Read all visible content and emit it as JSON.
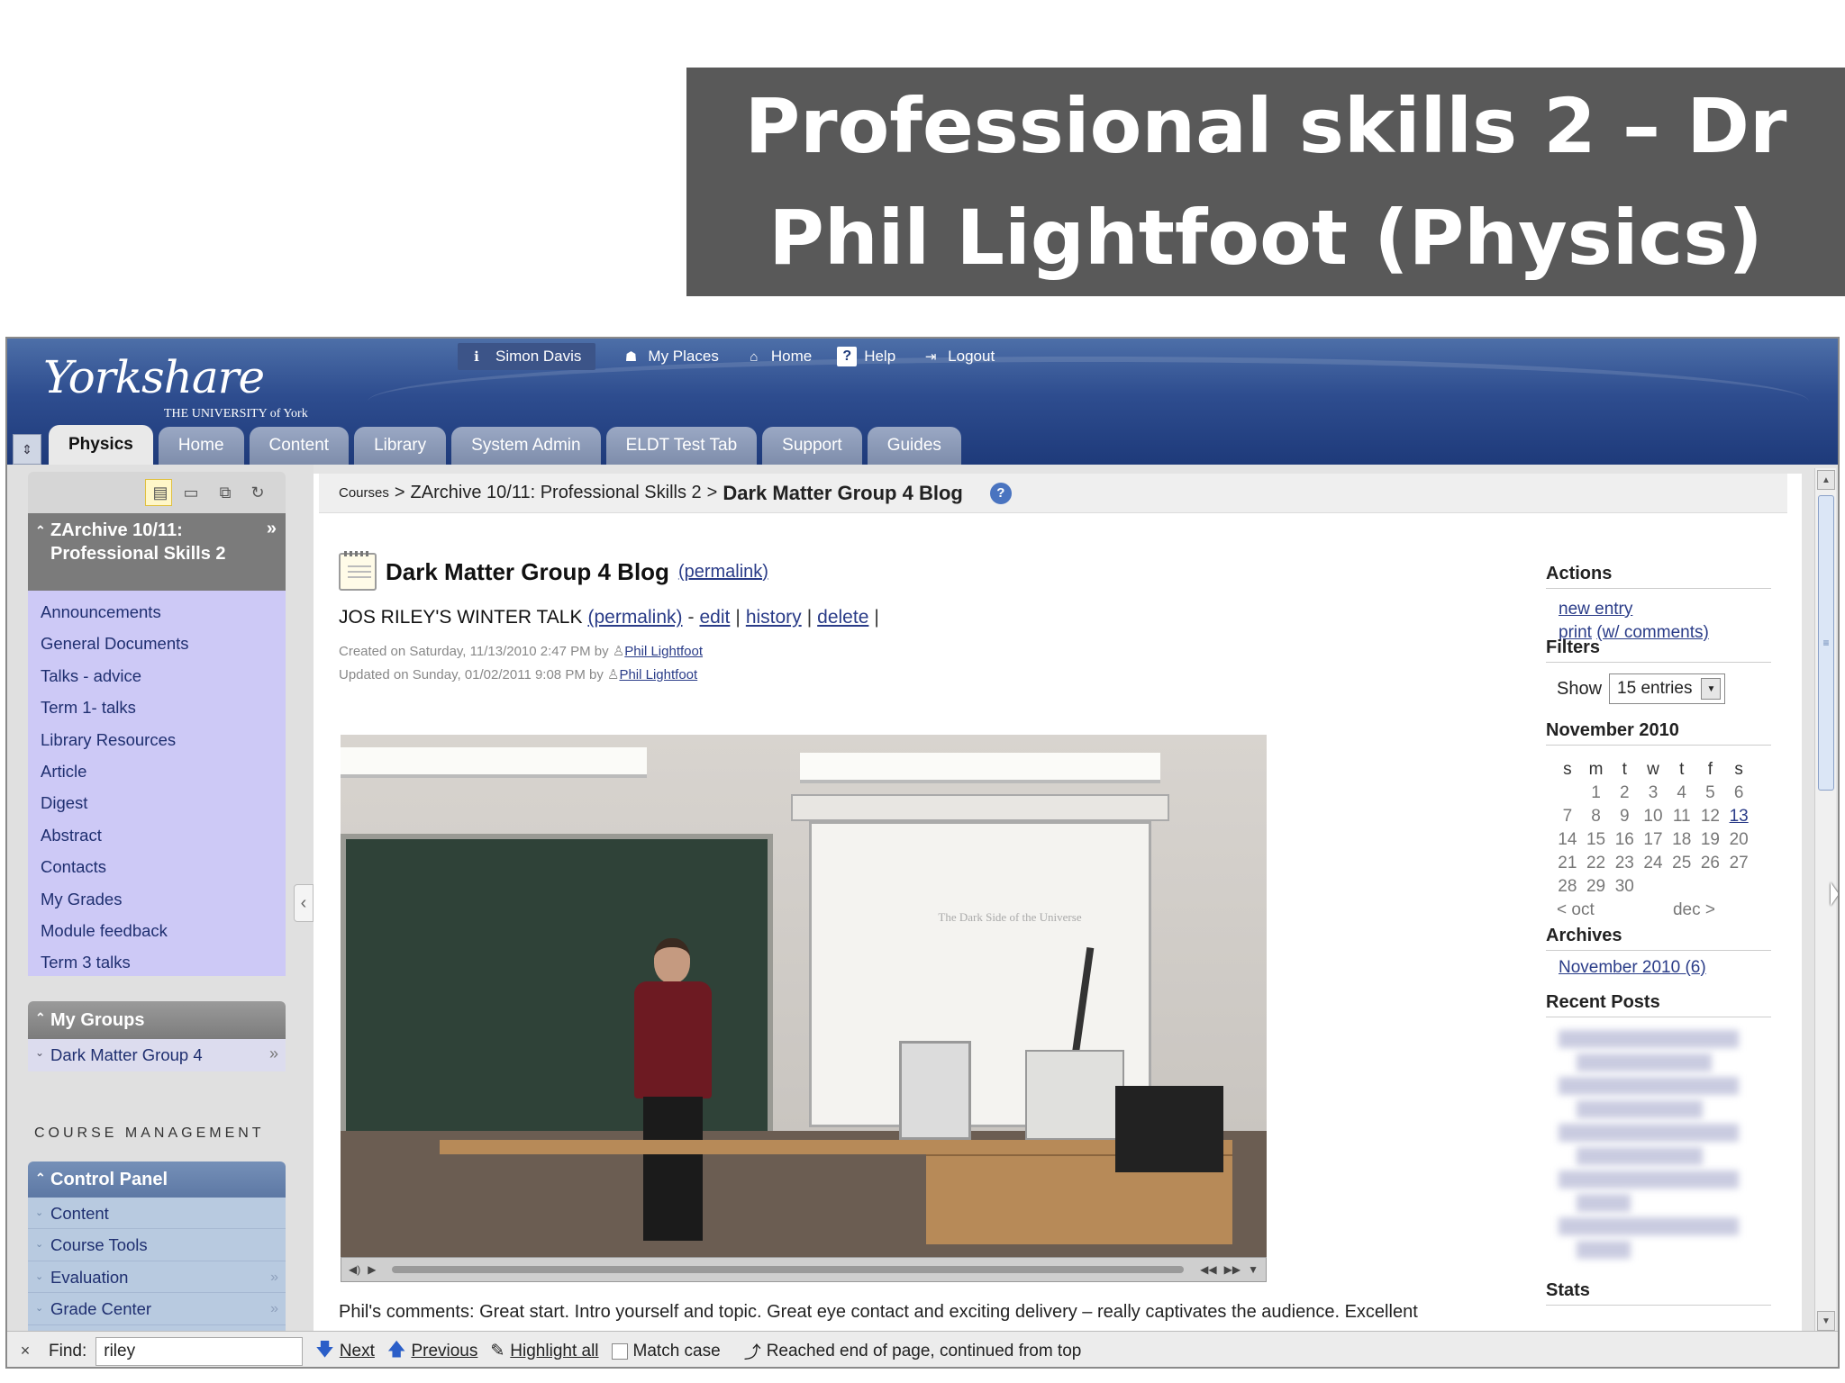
{
  "slide": {
    "title": "Professional skills 2 – Dr Phil Lightfoot (Physics)"
  },
  "header": {
    "logo_main": "Yorkshare",
    "logo_sub": "THE UNIVERSITY of York",
    "user": "Simon Davis",
    "top_links": [
      "My Places",
      "Home",
      "Help",
      "Logout"
    ]
  },
  "tabs": [
    "Physics",
    "Home",
    "Content",
    "Library",
    "System Admin",
    "ELDT Test Tab",
    "Support",
    "Guides"
  ],
  "leftnav": {
    "module_title": "ZArchive 10/11: Professional Skills 2",
    "module_links": [
      "Announcements",
      "General Documents",
      "Talks - advice",
      "Term 1- talks",
      "Library Resources",
      "Article",
      "Digest",
      "Abstract",
      "Contacts",
      "My Grades",
      "Module feedback",
      "Term 3 talks"
    ],
    "groups_title": "My Groups",
    "group_item": "Dark Matter Group 4",
    "course_management": "COURSE MANAGEMENT",
    "control_panel": "Control Panel",
    "cp_links": [
      "Content",
      "Course Tools",
      "Evaluation",
      "Grade Center"
    ]
  },
  "breadcrumb": {
    "root": "Courses",
    "module": "ZArchive 10/11: Professional Skills 2",
    "current": "Dark Matter Group 4 Blog",
    "sep": ">"
  },
  "blog": {
    "title": "Dark Matter Group 4 Blog",
    "permalink": "(permalink)",
    "entry_title": "JOS RILEY'S WINTER TALK",
    "entry_permalink": "(permalink)",
    "edit": "edit",
    "history": "history",
    "delete": "delete",
    "created_prefix": "Created on Saturday, 11/13/2010 2:47 PM by",
    "updated_prefix": "Updated on Sunday, 01/02/2011 9:08 PM by",
    "author": "Phil Lightfoot",
    "slide_text": "The Dark Side of the Universe",
    "comments": "Phil's comments: Great start. Intro yourself and topic. Great eye contact and exciting delivery – really captivates the audience. Excellent"
  },
  "sidebar": {
    "actions_heading": "Actions",
    "new_entry": "new entry",
    "print": "print",
    "print_comments": "(w/ comments)",
    "filters_heading": "Filters",
    "show_label": "Show",
    "show_value": "15 entries",
    "calendar_heading": "November 2010",
    "weekdays": [
      "s",
      "m",
      "t",
      "w",
      "t",
      "f",
      "s"
    ],
    "weeks": [
      [
        "",
        "1",
        "2",
        "3",
        "4",
        "5",
        "6"
      ],
      [
        "7",
        "8",
        "9",
        "10",
        "11",
        "12",
        "13"
      ],
      [
        "14",
        "15",
        "16",
        "17",
        "18",
        "19",
        "20"
      ],
      [
        "21",
        "22",
        "23",
        "24",
        "25",
        "26",
        "27"
      ],
      [
        "28",
        "29",
        "30",
        "",
        "",
        "",
        ""
      ]
    ],
    "prev_month": "< oct",
    "next_month": "dec >",
    "archives_heading": "Archives",
    "archive_link": "November 2010 (6)",
    "recent_heading": "Recent Posts",
    "stats_heading": "Stats"
  },
  "findbar": {
    "close": "×",
    "find_label": "Find:",
    "query": "riley",
    "next": "Next",
    "previous": "Previous",
    "highlight": "Highlight all",
    "match_case": "Match case",
    "status": "Reached end of page, continued from top"
  },
  "colors": {
    "title_band": "#595959",
    "header_blue": "#2e4d8f",
    "module_links_bg": "#cdc9f6",
    "control_panel_bg": "#b8cae0"
  }
}
